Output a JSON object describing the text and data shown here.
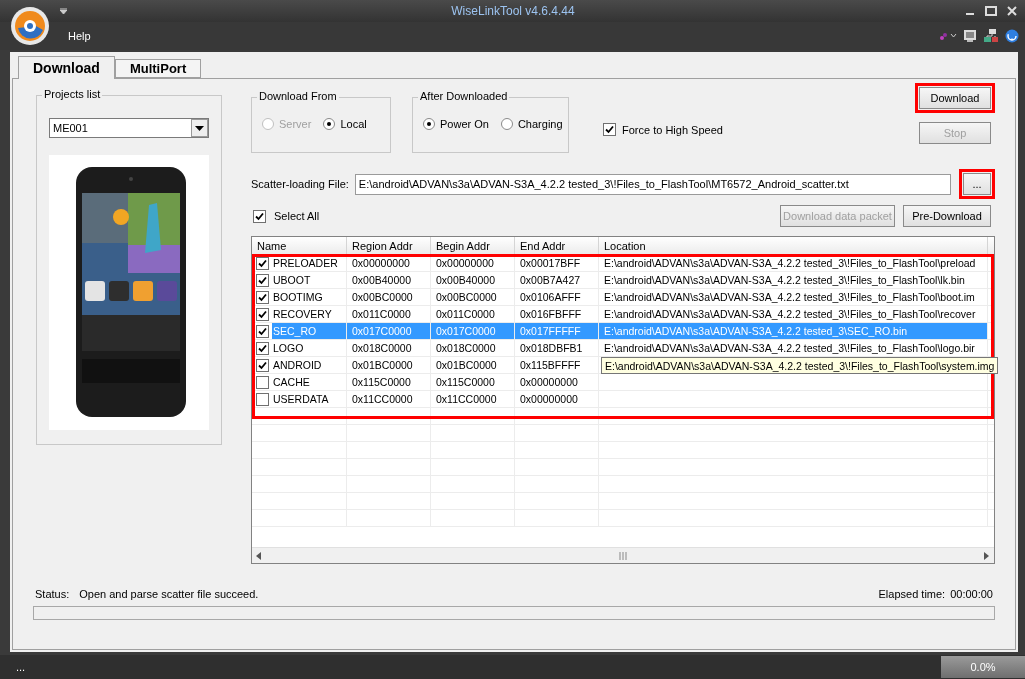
{
  "window": {
    "title": "WiseLinkTool v4.6.4.44"
  },
  "menu": [
    "Help"
  ],
  "tabs": [
    {
      "label": "Download",
      "selected": true
    },
    {
      "label": "MultiPort",
      "selected": false
    }
  ],
  "projects_list": {
    "title": "Projects list",
    "value": "ME001"
  },
  "download_from": {
    "title": "Download From",
    "options": [
      {
        "label": "Server",
        "selected": false,
        "disabled": true
      },
      {
        "label": "Local",
        "selected": true,
        "disabled": false
      }
    ]
  },
  "after_downloaded": {
    "title": "After Downloaded",
    "options": [
      {
        "label": "Power On",
        "selected": true,
        "disabled": false
      },
      {
        "label": "Charging",
        "selected": false,
        "disabled": false
      }
    ]
  },
  "force_high_speed": {
    "label": "Force to High Speed",
    "checked": true
  },
  "action_buttons": [
    {
      "label": "Download",
      "disabled": false,
      "highlighted": true
    },
    {
      "label": "Stop",
      "disabled": true,
      "highlighted": false
    }
  ],
  "scatter_file": {
    "label": "Scatter-loading File:",
    "value": "E:\\android\\ADVAN\\s3a\\ADVAN-S3A_4.2.2 tested_3\\!Files_to_FlashTool\\MT6572_Android_scatter.txt",
    "browse": {
      "label": "...",
      "highlighted": true
    }
  },
  "select_all": {
    "label": "Select All",
    "checked": true
  },
  "packet_buttons": [
    {
      "label": "Download data packet",
      "disabled": true
    },
    {
      "label": "Pre-Download",
      "disabled": false
    }
  ],
  "table": {
    "highlighted": true,
    "columns": [
      "Name",
      "Region Addr",
      "Begin Addr",
      "End Addr",
      "Location"
    ],
    "rows": [
      {
        "checked": true,
        "selected": false,
        "tooltip": false,
        "name": "PRELOADER",
        "region": "0x00000000",
        "begin": "0x00000000",
        "end": "0x00017BFF",
        "location": "E:\\android\\ADVAN\\s3a\\ADVAN-S3A_4.2.2 tested_3\\!Files_to_FlashTool\\preload"
      },
      {
        "checked": true,
        "selected": false,
        "tooltip": false,
        "name": "UBOOT",
        "region": "0x00B40000",
        "begin": "0x00B40000",
        "end": "0x00B7A427",
        "location": "E:\\android\\ADVAN\\s3a\\ADVAN-S3A_4.2.2 tested_3\\!Files_to_FlashTool\\lk.bin"
      },
      {
        "checked": true,
        "selected": false,
        "tooltip": false,
        "name": "BOOTIMG",
        "region": "0x00BC0000",
        "begin": "0x00BC0000",
        "end": "0x0106AFFF",
        "location": "E:\\android\\ADVAN\\s3a\\ADVAN-S3A_4.2.2 tested_3\\!Files_to_FlashTool\\boot.im"
      },
      {
        "checked": true,
        "selected": false,
        "tooltip": false,
        "name": "RECOVERY",
        "region": "0x011C0000",
        "begin": "0x011C0000",
        "end": "0x016FBFFF",
        "location": "E:\\android\\ADVAN\\s3a\\ADVAN-S3A_4.2.2 tested_3\\!Files_to_FlashTool\\recover"
      },
      {
        "checked": true,
        "selected": true,
        "tooltip": false,
        "name": "SEC_RO",
        "region": "0x017C0000",
        "begin": "0x017C0000",
        "end": "0x017FFFFF",
        "location": "E:\\android\\ADVAN\\s3a\\ADVAN-S3A_4.2.2 tested_3\\SEC_RO.bin"
      },
      {
        "checked": true,
        "selected": false,
        "tooltip": false,
        "name": "LOGO",
        "region": "0x018C0000",
        "begin": "0x018C0000",
        "end": "0x018DBFB1",
        "location": "E:\\android\\ADVAN\\s3a\\ADVAN-S3A_4.2.2 tested_3\\!Files_to_FlashTool\\logo.bir"
      },
      {
        "checked": true,
        "selected": false,
        "tooltip": true,
        "name": "ANDROID",
        "region": "0x01BC0000",
        "begin": "0x01BC0000",
        "end": "0x115BFFFF",
        "location": "E:\\android\\ADVAN\\s3a\\ADVAN-S3A_4.2.2 tested_3\\!Files_to_FlashTool\\system.img"
      },
      {
        "checked": false,
        "selected": false,
        "name": "CACHE",
        "region": "0x115C0000",
        "begin": "0x115C0000",
        "end": "0x00000000"
      },
      {
        "checked": false,
        "selected": false,
        "name": "USERDATA",
        "region": "0x11CC0000",
        "begin": "0x11CC0000",
        "end": "0x00000000"
      }
    ]
  },
  "status": {
    "label": "Status:",
    "text": "Open and parse scatter file succeed.",
    "elapsed_label": "Elapsed time:",
    "elapsed": "00:00:00",
    "progress": {
      "level": 0
    }
  },
  "status_bar": {
    "text": "...",
    "percent": "0.0%"
  }
}
